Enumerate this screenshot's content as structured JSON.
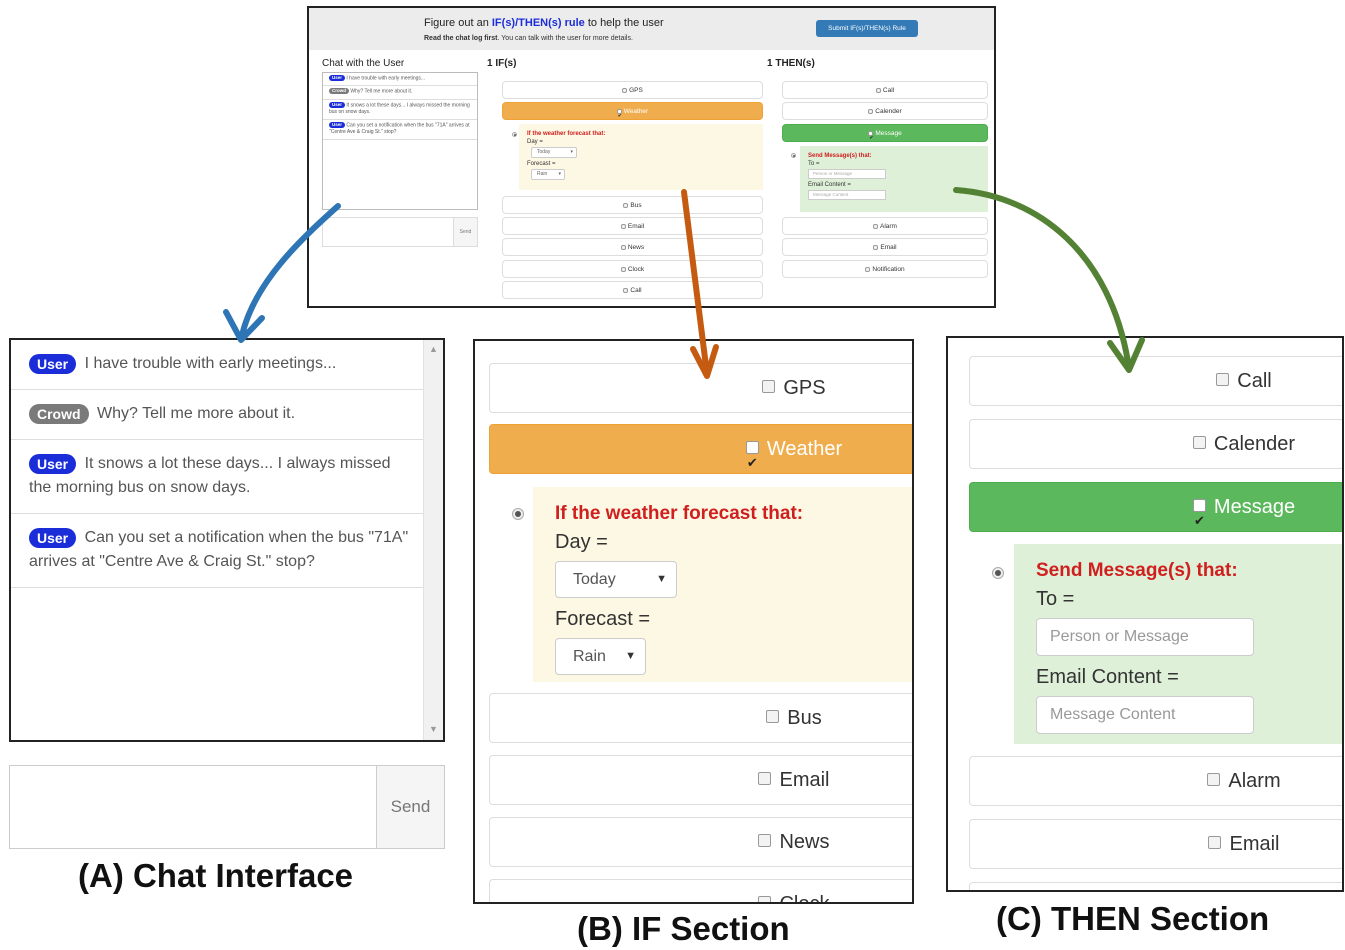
{
  "header": {
    "title_prefix": "Figure out an ",
    "title_highlight": "IF(s)/THEN(s) rule",
    "title_suffix": " to help the user",
    "subtitle_bold": "Read the chat log first",
    "subtitle_rest": ". You can talk with the user for more details.",
    "submit_label": "Submit IF(s)/THEN(s) Rule"
  },
  "chat": {
    "section_label": "Chat with the User",
    "messages": [
      {
        "role": "User",
        "text": "I have trouble with early meetings..."
      },
      {
        "role": "Crowd",
        "text": "Why? Tell me more about it."
      },
      {
        "role": "User",
        "text": "It snows a lot these days... I always missed the morning bus on snow days."
      },
      {
        "role": "User",
        "text": "Can you set a notification when the bus \"71A\" arrives at \"Centre Ave & Craig St.\" stop?"
      }
    ],
    "send_label": "Send"
  },
  "if_section": {
    "label": "1 IF(s)",
    "options": [
      "GPS",
      "Weather",
      "Bus",
      "Email",
      "News",
      "Clock",
      "Call"
    ],
    "selected": "Weather",
    "panel": {
      "title": "If the weather forecast that:",
      "day_label": "Day =",
      "day_value": "Today",
      "forecast_label": "Forecast =",
      "forecast_value": "Rain"
    }
  },
  "then_section": {
    "label": "1 THEN(s)",
    "options": [
      "Call",
      "Calender",
      "Message",
      "Alarm",
      "Email",
      "Notification"
    ],
    "selected": "Message",
    "panel": {
      "title": "Send Message(s) that:",
      "to_label": "To =",
      "to_placeholder": "Person or Message",
      "content_label": "Email Content =",
      "content_placeholder": "Message Content"
    }
  },
  "captions": {
    "a": "(A) Chat Interface",
    "b": "(B) IF Section",
    "c": "(C) THEN Section"
  },
  "colors": {
    "arrow_a": "#2e75b6",
    "arrow_b": "#c55a11",
    "arrow_c": "#548235",
    "badge_user": "#1a2dd8",
    "badge_crowd": "#7a7a7a",
    "selected_if": "#f0ad4e",
    "selected_then": "#5cb85c",
    "panel_if_bg": "#fcf8e3",
    "panel_then_bg": "#dff0d8",
    "panel_title": "#d01f1f"
  }
}
